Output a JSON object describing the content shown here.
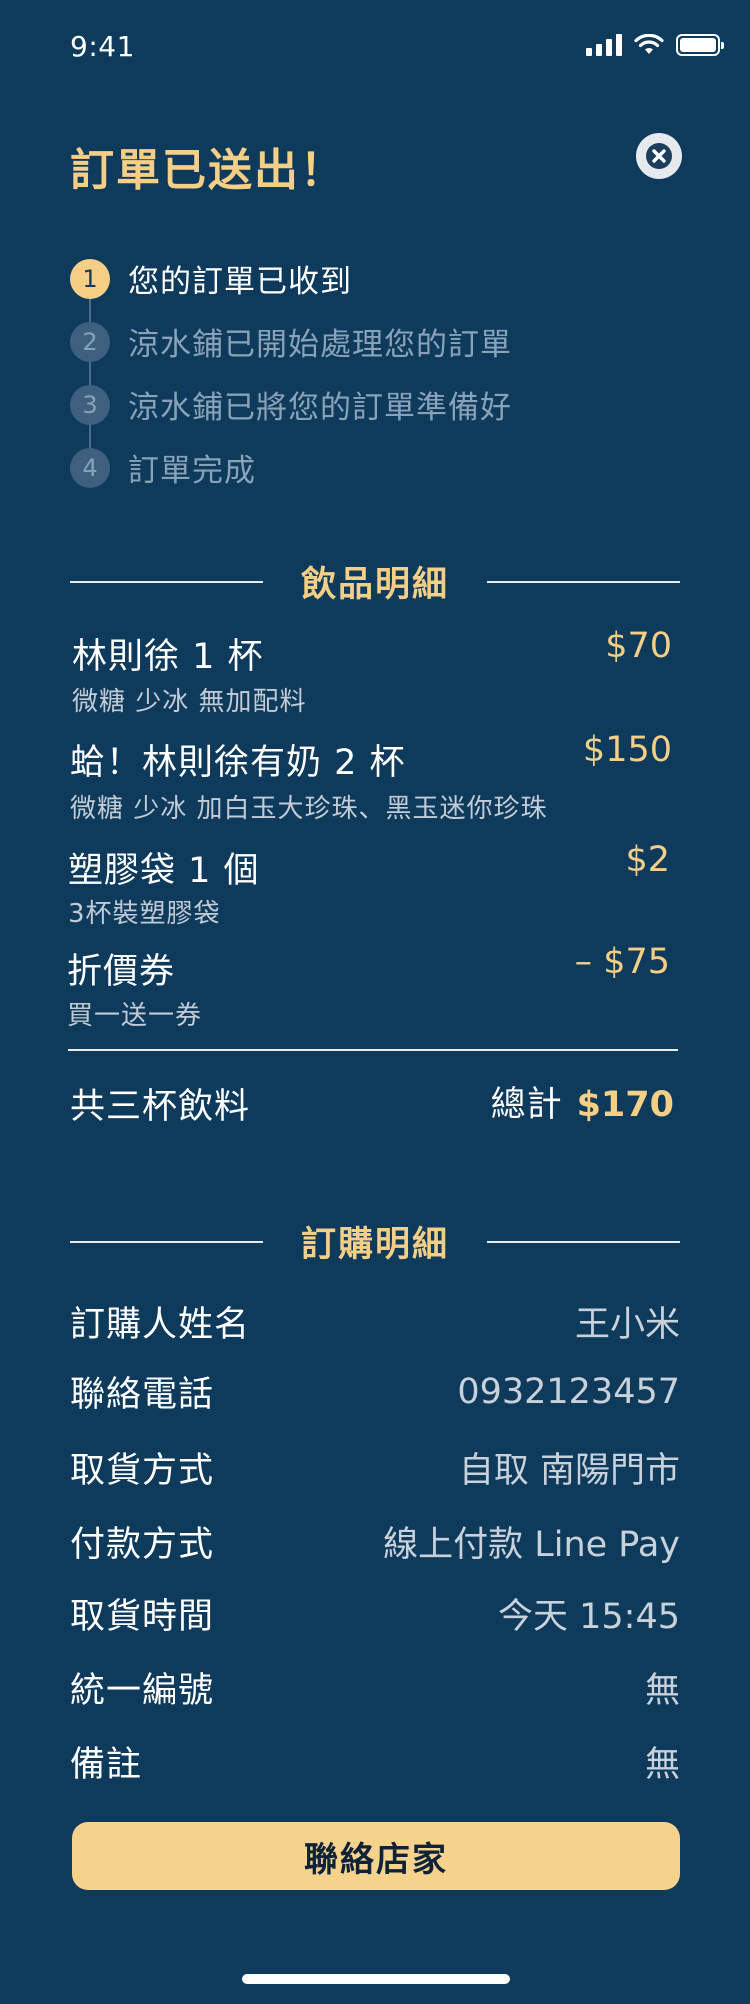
{
  "status_bar": {
    "time": "9:41"
  },
  "header": {
    "title": "訂單已送出！"
  },
  "steps": [
    {
      "number": "1",
      "label": "您的訂單已收到"
    },
    {
      "number": "2",
      "label": "涼水鋪已開始處理您的訂單"
    },
    {
      "number": "3",
      "label": "涼水鋪已將您的訂單準備好"
    },
    {
      "number": "4",
      "label": "訂單完成"
    }
  ],
  "drinks": {
    "section_title": "飲品明細",
    "items": [
      {
        "name": "林則徐 1 杯",
        "desc": "微糖 少冰 無加配料",
        "price": "$70"
      },
      {
        "name": "蛤！林則徐有奶 2 杯",
        "desc": "微糖 少冰 加白玉大珍珠、黑玉迷你珍珠",
        "price": "$150"
      },
      {
        "name": "塑膠袋 1 個",
        "desc": "3杯裝塑膠袋",
        "price": "$2"
      },
      {
        "name": "折價券",
        "desc": "買一送一券",
        "price": "– $75"
      }
    ],
    "summary_label": "共三杯飲料",
    "total_word": "總計",
    "total_amount": "$170"
  },
  "order": {
    "section_title": "訂購明細",
    "rows": [
      {
        "label": "訂購人姓名",
        "value": "王小米"
      },
      {
        "label": "聯絡電話",
        "value": "0932123457"
      },
      {
        "label": "取貨方式",
        "value": "自取 南陽門市"
      },
      {
        "label": "付款方式",
        "value": "線上付款 Line Pay"
      },
      {
        "label": "取貨時間",
        "value": "今天 15:45"
      },
      {
        "label": "統一編號",
        "value": "無"
      },
      {
        "label": "備註",
        "value": "無"
      }
    ]
  },
  "actions": {
    "contact_label": "聯絡店家"
  },
  "colors": {
    "background": "#0e3a5c",
    "accent": "#f6cf86",
    "button": "#f6d38c"
  }
}
